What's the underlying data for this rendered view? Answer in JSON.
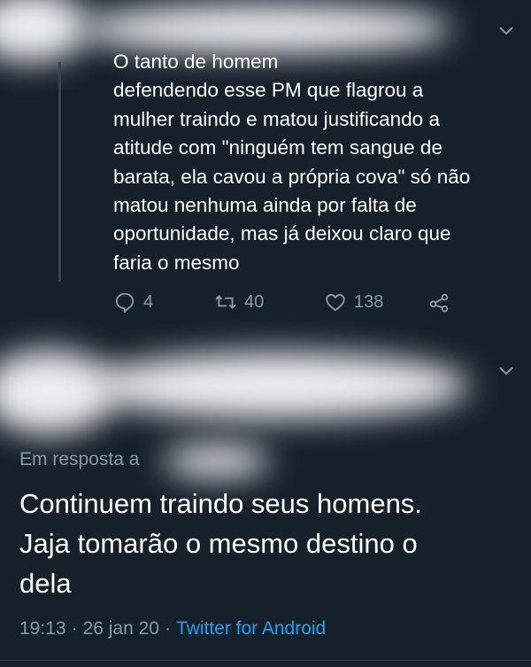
{
  "thread_tweet": {
    "text": "O tanto de homem\ndefendendo esse PM que flagrou a\nmulher traindo e matou justificando a\natitude com \"ninguém tem sangue de\nbarata, ela cavou a própria cova\" só não\nmatou nenhuma ainda por falta de\noportunidade, mas já deixou claro que\nfaria o mesmo",
    "replies": "4",
    "retweets": "40",
    "likes": "138"
  },
  "main_tweet": {
    "reply_to_label": "Em resposta a",
    "text": "Continuem traindo seus homens.\nJaja tomarão o mesmo destino o\ndela",
    "time": "19:13",
    "date": "26 jan 20",
    "separator": "·",
    "source": "Twitter for Android"
  },
  "colors": {
    "background": "#15202b",
    "text": "#ffffff",
    "muted": "#8899a6",
    "link": "#1da1f2"
  },
  "icons": [
    "chevron-down-icon",
    "reply-icon",
    "retweet-icon",
    "like-icon",
    "share-icon"
  ]
}
